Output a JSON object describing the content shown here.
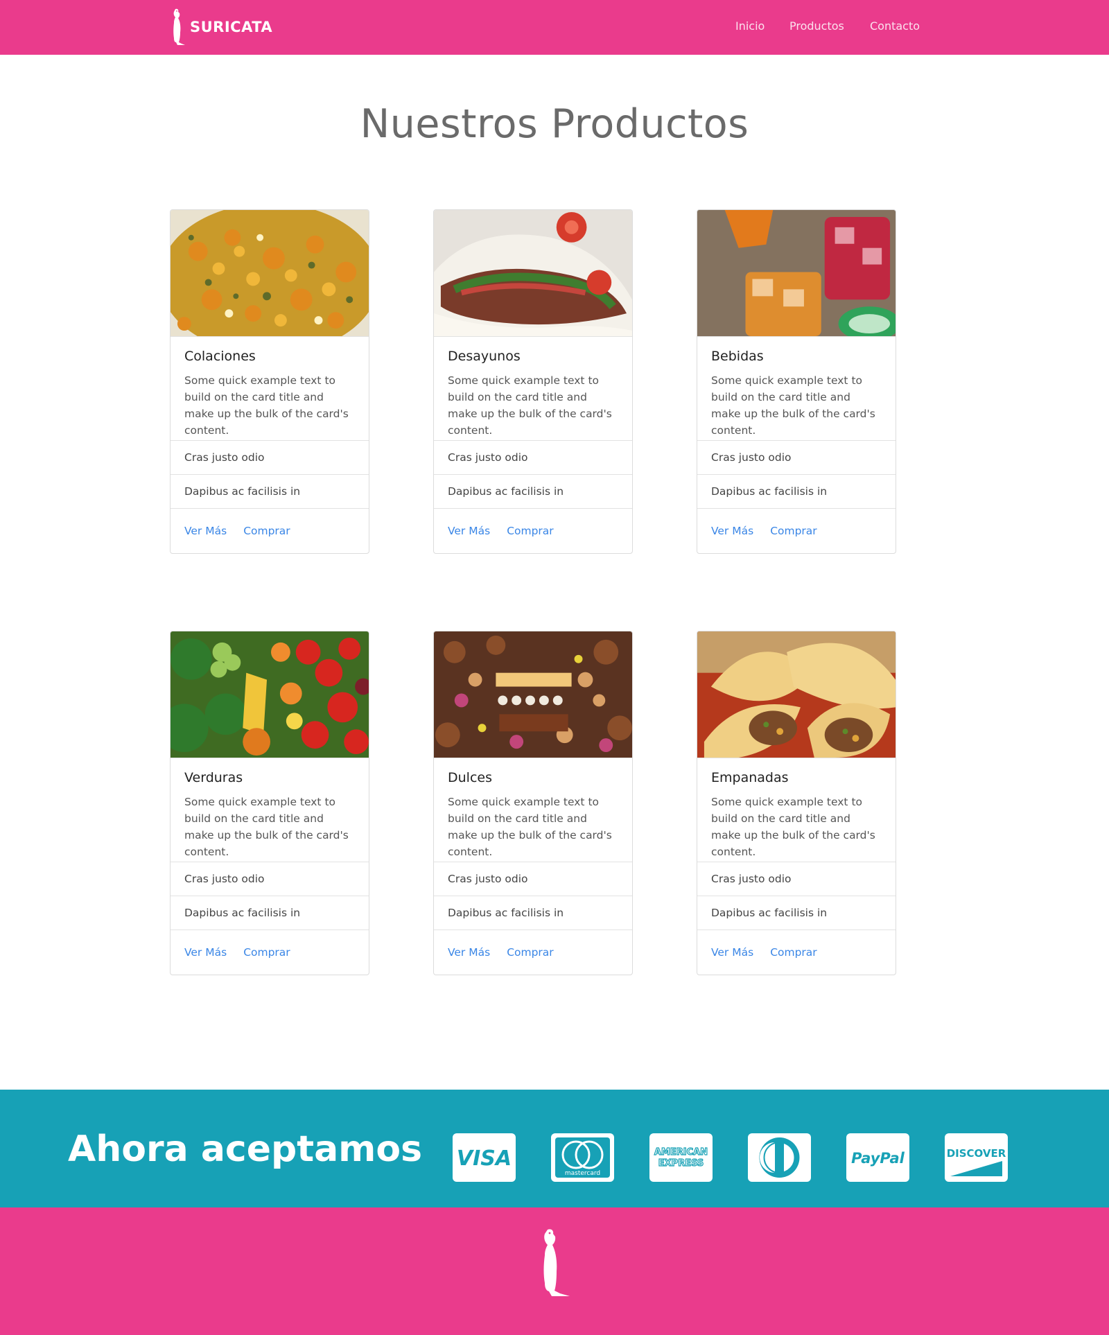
{
  "colors": {
    "brand_pink": "#ea3b8c",
    "accept_teal": "#17a1b6",
    "link_blue": "#3a86e6",
    "title_gray": "#6a6a6a"
  },
  "navbar": {
    "brand": "SURICATA",
    "links": [
      {
        "label": "Inicio"
      },
      {
        "label": "Productos"
      },
      {
        "label": "Contacto"
      }
    ]
  },
  "main": {
    "title": "Nuestros Productos",
    "cards": [
      {
        "title": "Colaciones",
        "text": "Some quick example text to build on the card title and make up the bulk of the card's content.",
        "items": [
          "Cras justo odio",
          "Dapibus ac facilisis in"
        ],
        "links": [
          "Ver Más",
          "Comprar"
        ],
        "image": "colaciones-photo"
      },
      {
        "title": "Desayunos",
        "text": "Some quick example text to build on the card title and make up the bulk of the card's content.",
        "items": [
          "Cras justo odio",
          "Dapibus ac facilisis in"
        ],
        "links": [
          "Ver Más",
          "Comprar"
        ],
        "image": "desayunos-photo"
      },
      {
        "title": "Bebidas",
        "text": "Some quick example text to build on the card title and make up the bulk of the card's content.",
        "items": [
          "Cras justo odio",
          "Dapibus ac facilisis in"
        ],
        "links": [
          "Ver Más",
          "Comprar"
        ],
        "image": "bebidas-photo"
      },
      {
        "title": "Verduras",
        "text": "Some quick example text to build on the card title and make up the bulk of the card's content.",
        "items": [
          "Cras justo odio",
          "Dapibus ac facilisis in"
        ],
        "links": [
          "Ver Más",
          "Comprar"
        ],
        "image": "verduras-photo"
      },
      {
        "title": "Dulces",
        "text": "Some quick example text to build on the card title and make up the bulk of the card's content.",
        "items": [
          "Cras justo odio",
          "Dapibus ac facilisis in"
        ],
        "links": [
          "Ver Más",
          "Comprar"
        ],
        "image": "dulces-photo"
      },
      {
        "title": "Empanadas",
        "text": "Some quick example text to build on the card title and make up the bulk of the card's content.",
        "items": [
          "Cras justo odio",
          "Dapibus ac facilisis in"
        ],
        "links": [
          "Ver Más",
          "Comprar"
        ],
        "image": "empanadas-photo"
      }
    ]
  },
  "accept": {
    "title": "Ahora aceptamos",
    "methods": [
      {
        "name": "visa-icon",
        "label": "VISA"
      },
      {
        "name": "mastercard-icon",
        "label": "mastercard"
      },
      {
        "name": "amex-icon",
        "label": "AMERICAN EXPRESS"
      },
      {
        "name": "diners-icon",
        "label": ""
      },
      {
        "name": "paypal-icon",
        "label": "PayPal"
      },
      {
        "name": "discover-icon",
        "label": "DISCOVER"
      }
    ]
  }
}
